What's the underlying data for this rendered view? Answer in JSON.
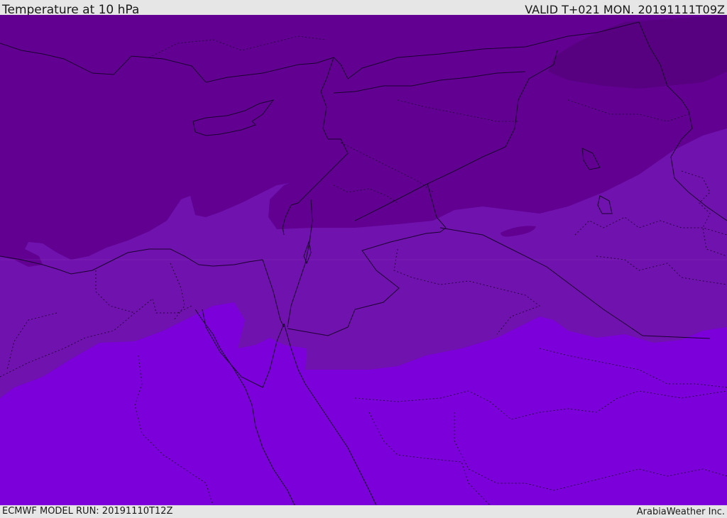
{
  "header": {
    "title": "Temperature at 10 hPa",
    "valid": "VALID T+021 MON. 20191111T09Z"
  },
  "footer": {
    "model_run": "ECMWF MODEL RUN: 20191110T12Z",
    "credit": "ArabiaWeather Inc."
  },
  "map": {
    "colors": {
      "darkest": "#570080",
      "dark": "#620092",
      "medium": "#7012ad",
      "light": "#7b00d9"
    }
  }
}
